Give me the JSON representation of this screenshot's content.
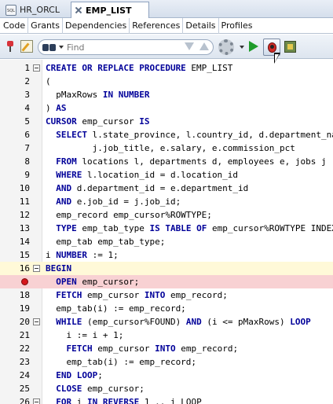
{
  "doc_tabs": [
    {
      "label": "HR_ORCL",
      "icon": "sql-icon"
    },
    {
      "label": "EMP_LIST",
      "icon": "procedure-icon",
      "active": true
    }
  ],
  "sub_tabs": [
    "Code",
    "Grants",
    "Dependencies",
    "References",
    "Details",
    "Profiles"
  ],
  "toolbar": {
    "search_placeholder": "Find",
    "icons": [
      "pin-icon",
      "edit-icon",
      "binoculars-icon",
      "arrow-down-icon",
      "arrow-up-icon",
      "gear-icon",
      "run-icon",
      "debug-icon",
      "profile-icon"
    ]
  },
  "colors": {
    "keyword": "#000099",
    "breakpoint_line": "#f8d1d3",
    "current_line": "#fff9d8",
    "breakpoint_dot": "#d5161b"
  },
  "code_lines": [
    {
      "num": "1",
      "fold": true,
      "tokens": [
        [
          "kw",
          "CREATE OR REPLACE PROCEDURE"
        ],
        [
          "t",
          " EMP_LIST"
        ]
      ]
    },
    {
      "num": "2",
      "tokens": [
        [
          "t",
          "("
        ]
      ]
    },
    {
      "num": "3",
      "tokens": [
        [
          "t",
          "  pMaxRows "
        ],
        [
          "kw",
          "IN NUMBER"
        ]
      ]
    },
    {
      "num": "4",
      "tokens": [
        [
          "t",
          ") "
        ],
        [
          "kw",
          "AS"
        ]
      ]
    },
    {
      "num": "5",
      "tokens": [
        [
          "kw",
          "CURSOR"
        ],
        [
          "t",
          " emp_cursor "
        ],
        [
          "kw",
          "IS"
        ]
      ]
    },
    {
      "num": "6",
      "tokens": [
        [
          "t",
          "  "
        ],
        [
          "kw",
          "SELECT"
        ],
        [
          "t",
          " l.state_province, l.country_id, d.department_name"
        ]
      ]
    },
    {
      "num": "7",
      "tokens": [
        [
          "t",
          "         j.job_title, e.salary, e.commission_pct"
        ]
      ]
    },
    {
      "num": "8",
      "tokens": [
        [
          "t",
          "  "
        ],
        [
          "kw",
          "FROM"
        ],
        [
          "t",
          " locations l, departments d, employees e, jobs j"
        ]
      ]
    },
    {
      "num": "9",
      "tokens": [
        [
          "t",
          "  "
        ],
        [
          "kw",
          "WHERE"
        ],
        [
          "t",
          " l.location_id = d.location_id"
        ]
      ]
    },
    {
      "num": "10",
      "tokens": [
        [
          "t",
          "  "
        ],
        [
          "kw",
          "AND"
        ],
        [
          "t",
          " d.department_id = e.department_id"
        ]
      ]
    },
    {
      "num": "11",
      "tokens": [
        [
          "t",
          "  "
        ],
        [
          "kw",
          "AND"
        ],
        [
          "t",
          " e.job_id = j.job_id;"
        ]
      ]
    },
    {
      "num": "12",
      "tokens": [
        [
          "t",
          "  emp_record emp_cursor%ROWTYPE;"
        ]
      ]
    },
    {
      "num": "13",
      "tokens": [
        [
          "t",
          "  "
        ],
        [
          "kw",
          "TYPE"
        ],
        [
          "t",
          " emp_tab_type "
        ],
        [
          "kw",
          "IS TABLE OF"
        ],
        [
          "t",
          " emp_cursor%ROWTYPE INDEX BY"
        ]
      ]
    },
    {
      "num": "14",
      "tokens": [
        [
          "t",
          "  emp_tab emp_tab_type;"
        ]
      ]
    },
    {
      "num": "15",
      "tokens": [
        [
          "t",
          "i "
        ],
        [
          "kw",
          "NUMBER"
        ],
        [
          "t",
          " := 1;"
        ]
      ]
    },
    {
      "num": "16",
      "fold": true,
      "current": true,
      "tokens": [
        [
          "kw",
          "BEGIN"
        ]
      ]
    },
    {
      "num": "",
      "breakpoint": true,
      "tokens": [
        [
          "t",
          "  "
        ],
        [
          "kw",
          "OPEN"
        ],
        [
          "t",
          " emp_cursor;"
        ]
      ]
    },
    {
      "num": "18",
      "tokens": [
        [
          "t",
          "  "
        ],
        [
          "kw",
          "FETCH"
        ],
        [
          "t",
          " emp_cursor "
        ],
        [
          "kw",
          "INTO"
        ],
        [
          "t",
          " emp_record;"
        ]
      ]
    },
    {
      "num": "19",
      "tokens": [
        [
          "t",
          "  emp_tab(i) := emp_record;"
        ]
      ]
    },
    {
      "num": "20",
      "fold": true,
      "tokens": [
        [
          "t",
          "  "
        ],
        [
          "kw",
          "WHILE"
        ],
        [
          "t",
          " (emp_cursor%FOUND) "
        ],
        [
          "kw",
          "AND"
        ],
        [
          "t",
          " (i <= pMaxRows) "
        ],
        [
          "kw",
          "LOOP"
        ]
      ]
    },
    {
      "num": "21",
      "tokens": [
        [
          "t",
          "    i := i + 1;"
        ]
      ]
    },
    {
      "num": "22",
      "tokens": [
        [
          "t",
          "    "
        ],
        [
          "kw",
          "FETCH"
        ],
        [
          "t",
          " emp_cursor "
        ],
        [
          "kw",
          "INTO"
        ],
        [
          "t",
          " emp_record;"
        ]
      ]
    },
    {
      "num": "23",
      "tokens": [
        [
          "t",
          "    emp_tab(i) := emp_record;"
        ]
      ]
    },
    {
      "num": "24",
      "tokens": [
        [
          "t",
          "  "
        ],
        [
          "kw",
          "END LOOP"
        ],
        [
          "t",
          ";"
        ]
      ]
    },
    {
      "num": "25",
      "tokens": [
        [
          "t",
          "  "
        ],
        [
          "kw",
          "CLOSE"
        ],
        [
          "t",
          " emp_cursor;"
        ]
      ]
    },
    {
      "num": "26",
      "fold": true,
      "tokens": [
        [
          "t",
          "  "
        ],
        [
          "kw",
          "FOR"
        ],
        [
          "t",
          " i "
        ],
        [
          "kw",
          "IN REVERSE"
        ],
        [
          "t",
          " 1 .. i LOOP"
        ]
      ]
    }
  ]
}
